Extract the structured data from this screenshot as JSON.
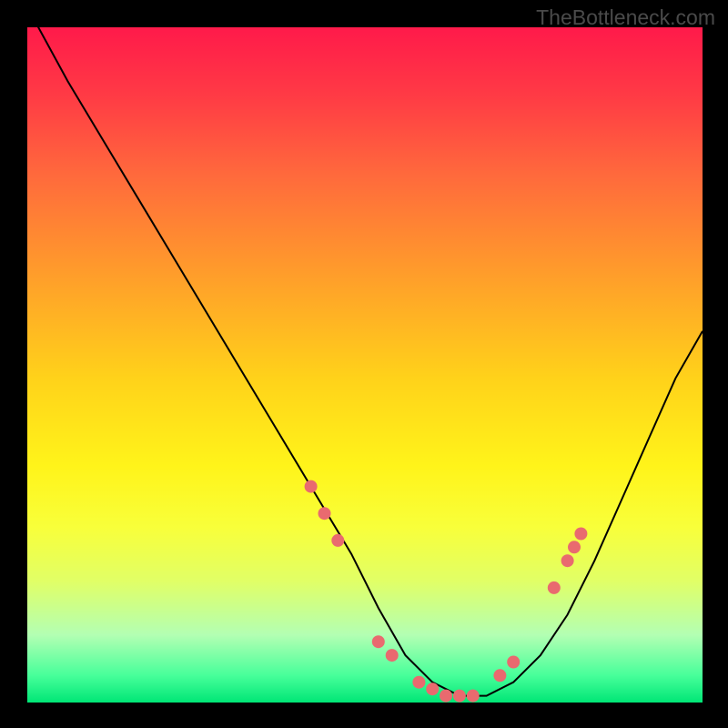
{
  "watermark": "TheBottleneck.com",
  "chart_data": {
    "type": "line",
    "title": "",
    "xlabel": "",
    "ylabel": "",
    "xlim": [
      0,
      100
    ],
    "ylim": [
      0,
      100
    ],
    "series": [
      {
        "name": "curve",
        "x": [
          0,
          6,
          12,
          18,
          24,
          30,
          36,
          42,
          48,
          52,
          56,
          60,
          64,
          68,
          72,
          76,
          80,
          84,
          88,
          92,
          96,
          100
        ],
        "y": [
          103,
          92,
          82,
          72,
          62,
          52,
          42,
          32,
          22,
          14,
          7,
          3,
          1,
          1,
          3,
          7,
          13,
          21,
          30,
          39,
          48,
          55
        ]
      }
    ],
    "markers": {
      "name": "points",
      "x": [
        42,
        44,
        46,
        52,
        54,
        58,
        60,
        62,
        64,
        66,
        70,
        72,
        78,
        80,
        81,
        82
      ],
      "y": [
        32,
        28,
        24,
        9,
        7,
        3,
        2,
        1,
        1,
        1,
        4,
        6,
        17,
        21,
        23,
        25
      ]
    },
    "gradient_stops": [
      {
        "pct": 0,
        "color": "#ff1a4a"
      },
      {
        "pct": 10,
        "color": "#ff3a45"
      },
      {
        "pct": 22,
        "color": "#ff6a3c"
      },
      {
        "pct": 38,
        "color": "#ffa229"
      },
      {
        "pct": 52,
        "color": "#ffd21a"
      },
      {
        "pct": 65,
        "color": "#fff41a"
      },
      {
        "pct": 74,
        "color": "#f8ff3a"
      },
      {
        "pct": 82,
        "color": "#e1ff66"
      },
      {
        "pct": 90,
        "color": "#b3ffb3"
      },
      {
        "pct": 96,
        "color": "#47ff9a"
      },
      {
        "pct": 100,
        "color": "#00e676"
      }
    ]
  }
}
